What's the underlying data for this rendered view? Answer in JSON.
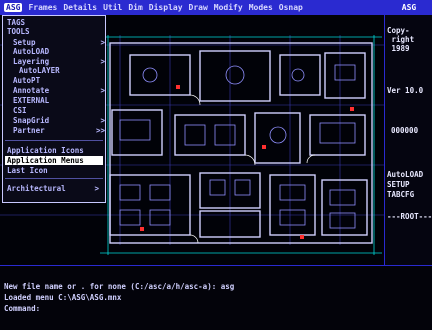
{
  "menubar": {
    "logo": "ASG",
    "items": [
      "Frames",
      "Details",
      "Util",
      "Dim",
      "Display",
      "Draw",
      "Modify",
      "Modes",
      "Osnap"
    ]
  },
  "sidemenu": {
    "header": "ASG",
    "copyright": "Copy-\n right\n 1989",
    "version": "Ver 10.0",
    "number": "000000",
    "autoload": "AutoLOAD",
    "setup": "SETUP",
    "tabcfg": "TABCFG",
    "root": "---ROOT---"
  },
  "dropdown": {
    "items": [
      {
        "label": "TAGS",
        "arrow": "",
        "indent": false
      },
      {
        "label": "TOOLS",
        "arrow": "",
        "indent": false
      },
      {
        "label": "Setup",
        "arrow": ">",
        "indent": true
      },
      {
        "label": "AutoLOAD",
        "arrow": "",
        "indent": true
      },
      {
        "label": "Layering",
        "arrow": ">",
        "indent": true
      },
      {
        "label": "AutoLAYER",
        "arrow": "",
        "indent": true
      },
      {
        "label": "AutoPT",
        "arrow": "",
        "indent": true
      },
      {
        "label": "Annotate",
        "arrow": ">",
        "indent": true
      },
      {
        "label": "EXTERNAL",
        "arrow": "",
        "indent": true
      },
      {
        "label": "CSI",
        "arrow": "",
        "indent": true
      },
      {
        "label": "SnapGrid",
        "arrow": ">",
        "indent": true
      },
      {
        "label": "Partner",
        "arrow": ">>",
        "indent": true
      },
      {
        "label": "Application Icons",
        "arrow": "",
        "indent": false
      },
      {
        "label": "Application Menus",
        "arrow": "",
        "indent": false
      },
      {
        "label": "Last Icon",
        "arrow": "",
        "indent": false
      },
      {
        "label": "Architectural",
        "arrow": ">",
        "indent": false
      }
    ]
  },
  "command": {
    "lines": [
      "New file name or . for none (C:/asc/a/h/asc-a): asg",
      "Loaded menu C:\\ASG\\ASG.mnx",
      "Command:"
    ]
  },
  "colors": {
    "menubar": "#2a2ad0",
    "drawing_lines": "#c8c8ff",
    "dim_lines": "#00e0e0",
    "accent_red": "#ff3030"
  }
}
